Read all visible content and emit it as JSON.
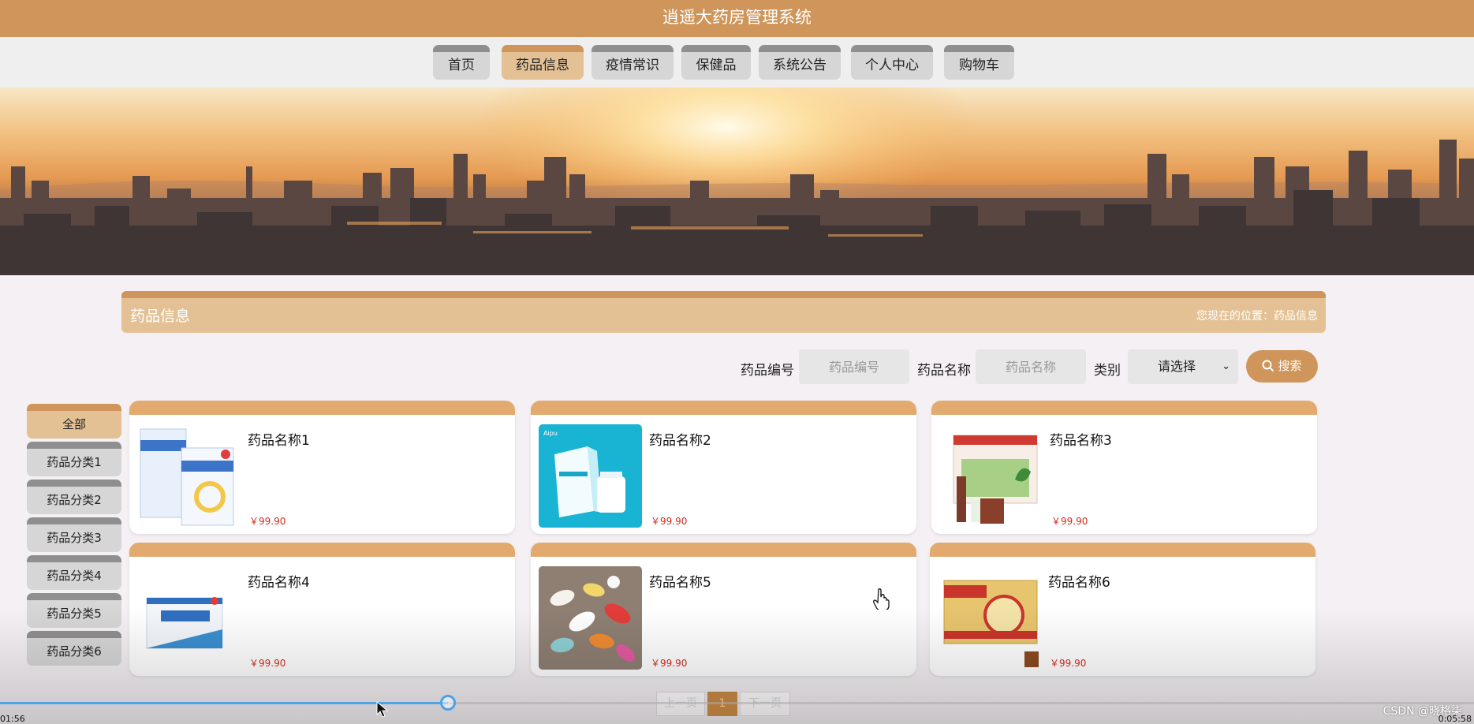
{
  "header": {
    "title": "逍遥大药房管理系统"
  },
  "nav": {
    "items": [
      {
        "label": "首页"
      },
      {
        "label": "药品信息"
      },
      {
        "label": "疫情常识"
      },
      {
        "label": "保健品"
      },
      {
        "label": "系统公告"
      },
      {
        "label": "个人中心"
      },
      {
        "label": "购物车"
      }
    ],
    "active": "药品信息"
  },
  "section": {
    "title": "药品信息",
    "breadcrumb": "您现在的位置：药品信息"
  },
  "search": {
    "code_label": "药品编号",
    "code_placeholder": "药品编号",
    "name_label": "药品名称",
    "name_placeholder": "药品名称",
    "category_label": "类别",
    "category_selected": "请选择",
    "button_label": "搜索"
  },
  "categories": [
    {
      "label": "全部"
    },
    {
      "label": "药品分类1"
    },
    {
      "label": "药品分类2"
    },
    {
      "label": "药品分类3"
    },
    {
      "label": "药品分类4"
    },
    {
      "label": "药品分类5"
    },
    {
      "label": "药品分类6"
    }
  ],
  "products": [
    {
      "name": "药品名称1",
      "price": "￥99.90"
    },
    {
      "name": "药品名称2",
      "price": "￥99.90"
    },
    {
      "name": "药品名称3",
      "price": "￥99.90"
    },
    {
      "name": "药品名称4",
      "price": "￥99.90"
    },
    {
      "name": "药品名称5",
      "price": "￥99.90"
    },
    {
      "name": "药品名称6",
      "price": "￥99.90"
    }
  ],
  "pagination": {
    "prev": "上一页",
    "current": "1",
    "next": "下一页"
  },
  "video": {
    "elapsed": "01:56",
    "duration": "0:05:58",
    "progress": 0.32
  },
  "watermark": "CSDN @晓格柒",
  "colors": {
    "accent": "#cf955a",
    "accent_light": "#e3c194",
    "price": "#d42a1e"
  }
}
